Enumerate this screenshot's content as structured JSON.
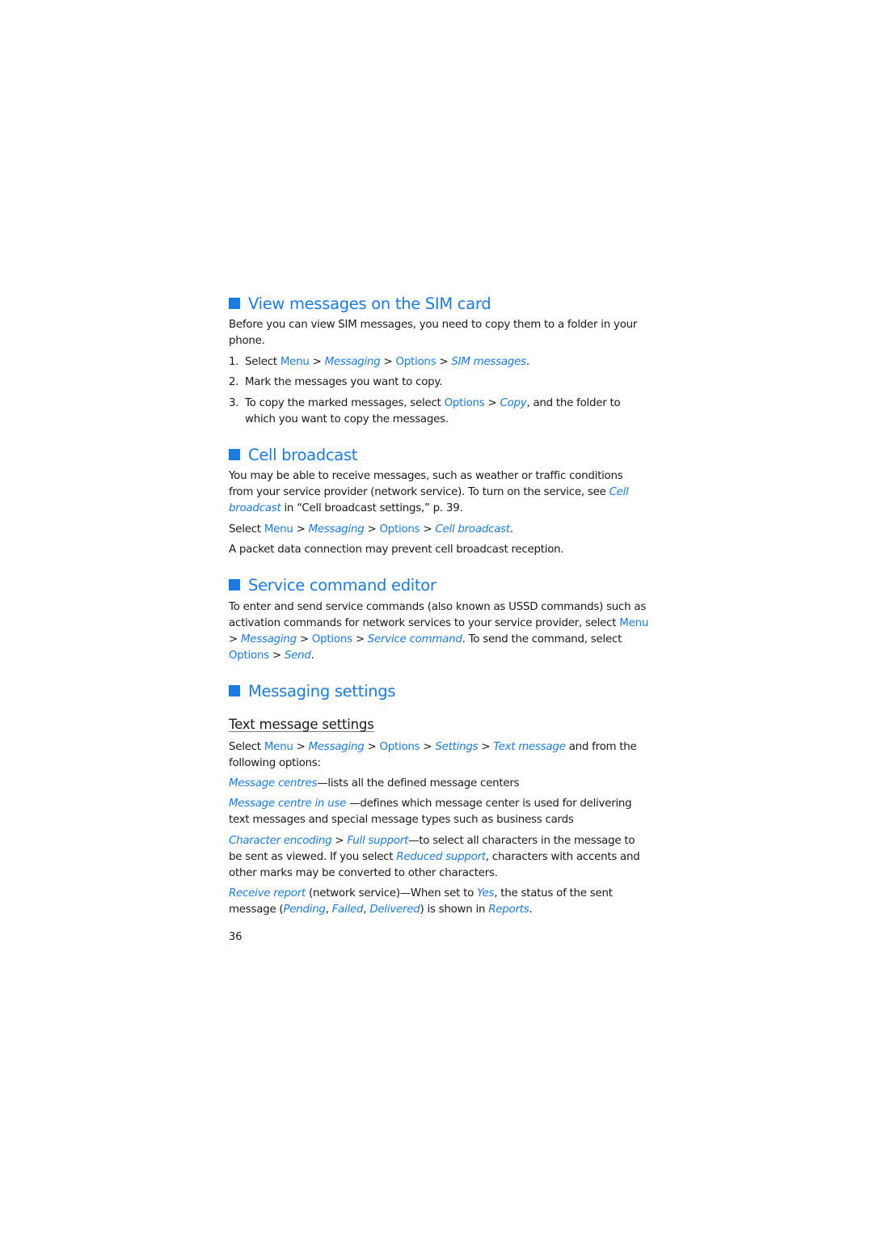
{
  "colors": {
    "accent": "#1a7be6",
    "text": "#1a1a1a"
  },
  "sections": {
    "sim": {
      "title": "View messages on the SIM card",
      "intro": "Before you can view SIM messages, you need to copy them to a folder in your phone.",
      "steps": [
        {
          "num": "1.",
          "p1": "Select ",
          "menu": "Menu",
          "sep1": " > ",
          "messaging": "Messaging",
          "sep2": " > ",
          "options": "Options",
          "sep3": " > ",
          "target": "SIM messages",
          "end": "."
        },
        {
          "num": "2.",
          "text": "Mark the messages you want to copy."
        },
        {
          "num": "3.",
          "p1": "To copy the marked messages, select ",
          "options": "Options",
          "sep1": " > ",
          "copy": "Copy",
          "p2": ", and the folder to which you want to copy the messages."
        }
      ]
    },
    "cell": {
      "title": "Cell broadcast",
      "intro_p1": "You may be able to receive messages, such as weather or traffic conditions from your service provider (network service). To turn on the service, see ",
      "intro_link": "Cell broadcast",
      "intro_p2": " in “Cell broadcast settings,” p. 39.",
      "select": {
        "p1": "Select ",
        "menu": "Menu",
        "sep1": " > ",
        "messaging": "Messaging",
        "sep2": " > ",
        "options": "Options",
        "sep3": " > ",
        "target": "Cell broadcast",
        "end": "."
      },
      "note": "A packet data connection may prevent cell broadcast reception."
    },
    "service": {
      "title": "Service command editor",
      "p1": "To enter and send service commands (also known as USSD commands) such as activation commands for network services to your service provider, select ",
      "menu": "Menu",
      "sep1": " > ",
      "messaging": "Messaging",
      "sep2": " > ",
      "options": "Options",
      "sep3": " > ",
      "command": "Service command",
      "p2": ". To send the command, select ",
      "options2": "Options",
      "sep4": " > ",
      "send": "Send",
      "end": "."
    },
    "settings": {
      "title": "Messaging settings",
      "subtitle": "Text message settings",
      "select": {
        "p1": "Select ",
        "menu": "Menu",
        "sep1": " > ",
        "messaging": "Messaging",
        "sep2": " > ",
        "options": "Options",
        "sep3": " > ",
        "settings": "Settings",
        "sep4": " > ",
        "text_message": "Text message",
        "p2": " and from the following options:"
      },
      "items": {
        "centres": {
          "term": "Message centres",
          "desc": "—lists all the defined message centers"
        },
        "in_use": {
          "term": "Message centre in use",
          "desc": " —defines which message center is used for delivering text messages and special message types such as business cards"
        },
        "encoding": {
          "term": "Character encoding",
          "sep": " > ",
          "full": "Full support",
          "p1": "—to select all characters in the message to be sent as viewed. If you select ",
          "reduced": "Reduced support",
          "p2": ", characters with accents and other marks may be converted to other characters."
        },
        "report": {
          "term": "Receive report",
          "p1": " (network service)—When set to ",
          "yes": "Yes",
          "p2": ", the status of the sent message (",
          "pending": "Pending",
          "c1": ", ",
          "failed": "Failed",
          "c2": ", ",
          "delivered": "Delivered",
          "p3": ") is shown in ",
          "reports": "Reports",
          "end": "."
        }
      }
    }
  },
  "page_number": "36"
}
